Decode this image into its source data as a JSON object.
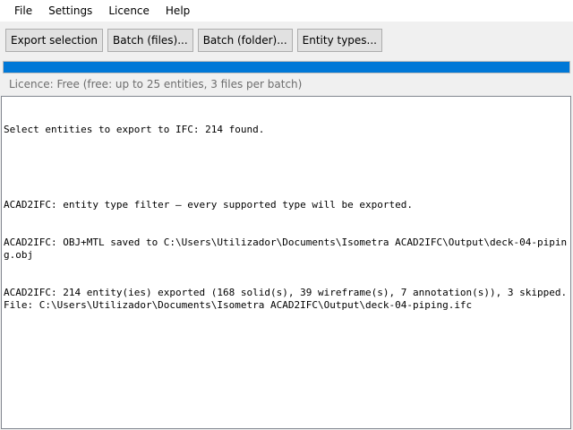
{
  "menu": {
    "items": [
      "File",
      "Settings",
      "Licence",
      "Help"
    ]
  },
  "toolbar": {
    "export_selection_label": "Export selection",
    "batch_files_label": "Batch (files)...",
    "batch_folder_label": "Batch (folder)...",
    "entity_types_label": "Entity types..."
  },
  "progress": {
    "value_percent": 100,
    "color": "#0078d7"
  },
  "licence": {
    "text": "Licence: Free (free: up to 25 entities, 3 files per batch)"
  },
  "log": {
    "lines": [
      "Select entities to export to IFC: 214 found.",
      "",
      "ACAD2IFC: entity type filter — every supported type will be exported.",
      "ACAD2IFC: OBJ+MTL saved to C:\\Users\\Utilizador\\Documents\\Isometra ACAD2IFC\\Output\\deck-04-piping.obj",
      "ACAD2IFC: 214 entity(ies) exported (168 solid(s), 39 wireframe(s), 7 annotation(s)), 3 skipped. File: C:\\Users\\Utilizador\\Documents\\Isometra ACAD2IFC\\Output\\deck-04-piping.ifc"
    ]
  }
}
